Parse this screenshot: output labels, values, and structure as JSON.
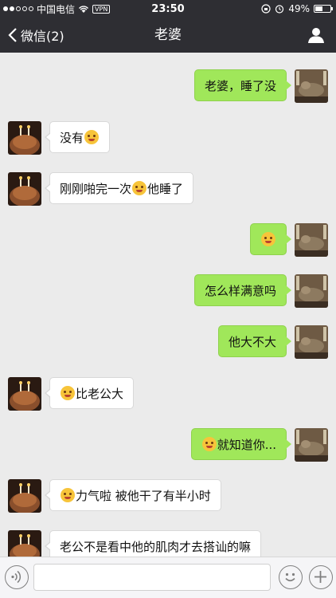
{
  "status_bar": {
    "carrier": "中国电信",
    "vpn": "VPN",
    "time": "23:50",
    "battery": "49%",
    "battery_level": 0.49
  },
  "nav": {
    "back_label": "微信(2)",
    "title": "老婆"
  },
  "messages": [
    {
      "side": "out",
      "text": "老婆，睡了没"
    },
    {
      "side": "in",
      "text": "没有",
      "emoji_after": "tongue-wink"
    },
    {
      "side": "in",
      "text_before": "刚刚啪完一次",
      "emoji": "heart-eyes",
      "text_after": "他睡了"
    },
    {
      "side": "out",
      "emoji": "star-eyes"
    },
    {
      "side": "out",
      "text": "怎么样满意吗"
    },
    {
      "side": "out",
      "text": "他大不大"
    },
    {
      "side": "in",
      "emoji": "thinking",
      "text": "比老公大"
    },
    {
      "side": "out",
      "emoji": "smirk",
      "text": "就知道你..."
    },
    {
      "side": "in",
      "emoji": "heart-eyes",
      "text": "力气啦 被他干了有半小时"
    },
    {
      "side": "in",
      "text": "老公不是看中他的肌肉才去搭讪的嘛"
    }
  ],
  "colors": {
    "header": "#2e2e33",
    "chat_bg": "#ebebeb",
    "out_bubble": "#a0e75a",
    "in_bubble": "#ffffff"
  }
}
